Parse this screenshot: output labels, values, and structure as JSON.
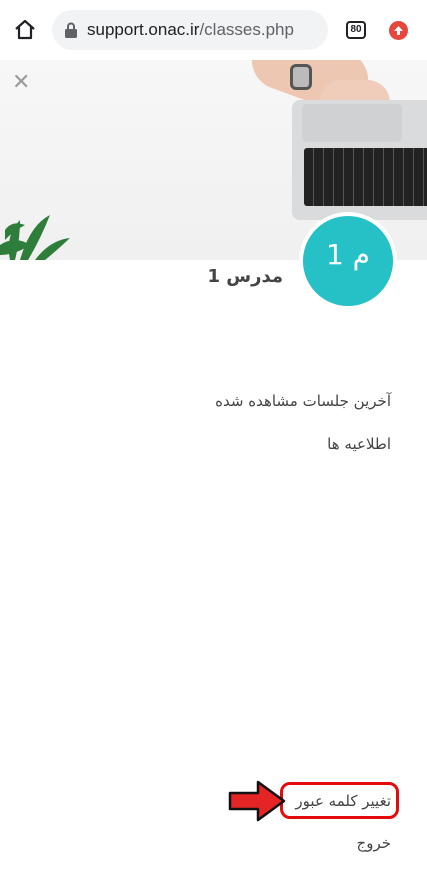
{
  "browser": {
    "url_host": "support.onac.ir",
    "url_path": "/classes.php",
    "tab_count": "80"
  },
  "profile": {
    "avatar_text": "م 1",
    "name": "مدرس 1"
  },
  "menu": {
    "recent_sessions": "آخرین جلسات مشاهده شده",
    "notices": "اطلاعیه ها",
    "change_password": "تغییر کلمه عبور",
    "logout": "خروج"
  },
  "colors": {
    "avatar_bg": "#26c0c7",
    "highlight": "#e30b0b"
  },
  "icons": {
    "home": "home-icon",
    "lock": "lock-icon",
    "close": "close-icon",
    "update": "update-arrow-icon"
  }
}
